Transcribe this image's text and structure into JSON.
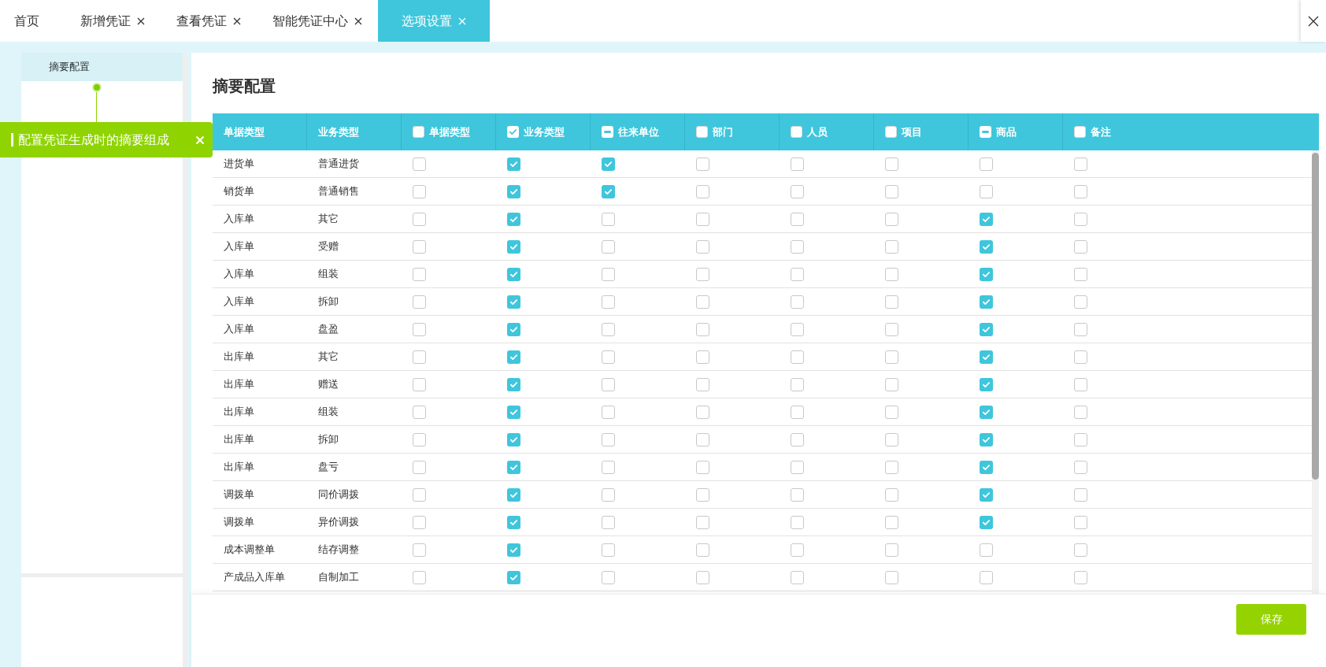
{
  "tabs": [
    {
      "label": "首页",
      "closable": false,
      "selected": false
    },
    {
      "label": "新增凭证",
      "closable": true,
      "selected": false
    },
    {
      "label": "查看凭证",
      "closable": true,
      "selected": false
    },
    {
      "label": "智能凭证中心",
      "closable": true,
      "selected": false
    },
    {
      "label": "选项设置",
      "closable": true,
      "selected": true
    }
  ],
  "sidebar": {
    "items": [
      {
        "label": "摘要配置",
        "selected": true
      }
    ]
  },
  "tooltip": {
    "text": "配置凭证生成时的摘要组成"
  },
  "page_title": "摘要配置",
  "table": {
    "columns": [
      {
        "label": "单据类型"
      },
      {
        "label": "业务类型"
      },
      {
        "label": "单据类型",
        "checked": false,
        "partial": false
      },
      {
        "label": "业务类型",
        "checked": true,
        "partial": false
      },
      {
        "label": "往来单位",
        "checked": false,
        "partial": true
      },
      {
        "label": "部门",
        "checked": false,
        "partial": false
      },
      {
        "label": "人员",
        "checked": false,
        "partial": false
      },
      {
        "label": "项目",
        "checked": false,
        "partial": false
      },
      {
        "label": "商品",
        "checked": false,
        "partial": true
      },
      {
        "label": "备注",
        "checked": false,
        "partial": false
      }
    ],
    "rows": [
      {
        "doc_type": "进货单",
        "biz_type": "普通进货",
        "checks": [
          false,
          true,
          true,
          false,
          false,
          false,
          false,
          false
        ]
      },
      {
        "doc_type": "销货单",
        "biz_type": "普通销售",
        "checks": [
          false,
          true,
          true,
          false,
          false,
          false,
          false,
          false
        ]
      },
      {
        "doc_type": "入库单",
        "biz_type": "其它",
        "checks": [
          false,
          true,
          false,
          false,
          false,
          false,
          true,
          false
        ]
      },
      {
        "doc_type": "入库单",
        "biz_type": "受赠",
        "checks": [
          false,
          true,
          false,
          false,
          false,
          false,
          true,
          false
        ]
      },
      {
        "doc_type": "入库单",
        "biz_type": "组装",
        "checks": [
          false,
          true,
          false,
          false,
          false,
          false,
          true,
          false
        ]
      },
      {
        "doc_type": "入库单",
        "biz_type": "拆卸",
        "checks": [
          false,
          true,
          false,
          false,
          false,
          false,
          true,
          false
        ]
      },
      {
        "doc_type": "入库单",
        "biz_type": "盘盈",
        "checks": [
          false,
          true,
          false,
          false,
          false,
          false,
          true,
          false
        ]
      },
      {
        "doc_type": "出库单",
        "biz_type": "其它",
        "checks": [
          false,
          true,
          false,
          false,
          false,
          false,
          true,
          false
        ]
      },
      {
        "doc_type": "出库单",
        "biz_type": "赠送",
        "checks": [
          false,
          true,
          false,
          false,
          false,
          false,
          true,
          false
        ]
      },
      {
        "doc_type": "出库单",
        "biz_type": "组装",
        "checks": [
          false,
          true,
          false,
          false,
          false,
          false,
          true,
          false
        ]
      },
      {
        "doc_type": "出库单",
        "biz_type": "拆卸",
        "checks": [
          false,
          true,
          false,
          false,
          false,
          false,
          true,
          false
        ]
      },
      {
        "doc_type": "出库单",
        "biz_type": "盘亏",
        "checks": [
          false,
          true,
          false,
          false,
          false,
          false,
          true,
          false
        ]
      },
      {
        "doc_type": "调拨单",
        "biz_type": "同价调拨",
        "checks": [
          false,
          true,
          false,
          false,
          false,
          false,
          true,
          false
        ]
      },
      {
        "doc_type": "调拨单",
        "biz_type": "异价调拨",
        "checks": [
          false,
          true,
          false,
          false,
          false,
          false,
          true,
          false
        ]
      },
      {
        "doc_type": "成本调整单",
        "biz_type": "结存调整",
        "checks": [
          false,
          true,
          false,
          false,
          false,
          false,
          false,
          false
        ]
      },
      {
        "doc_type": "产成品入库单",
        "biz_type": "自制加工",
        "checks": [
          false,
          true,
          false,
          false,
          false,
          false,
          false,
          false
        ]
      }
    ]
  },
  "save_button": "保存"
}
